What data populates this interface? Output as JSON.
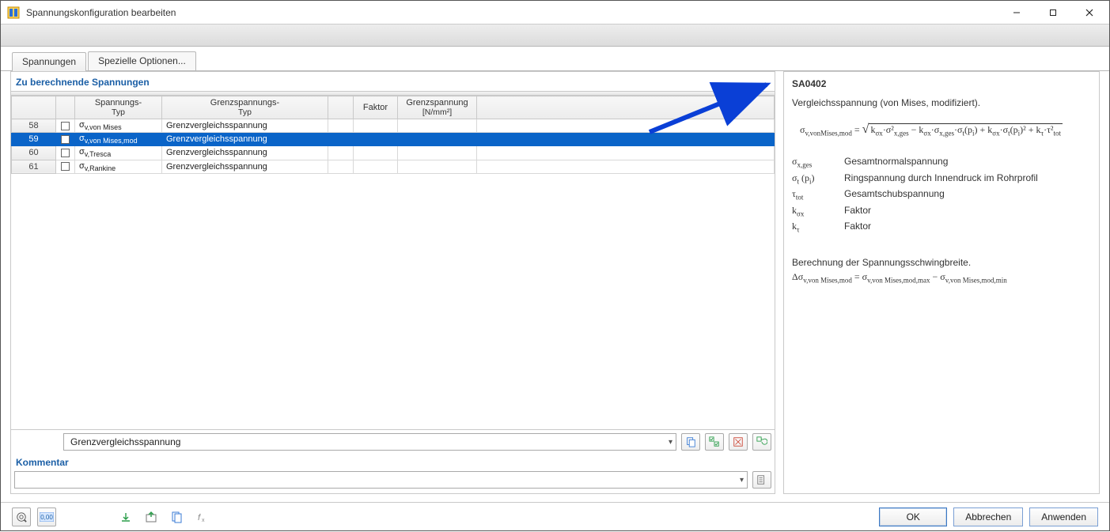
{
  "window": {
    "title": "Spannungskonfiguration bearbeiten"
  },
  "tabs": {
    "t1": "Spannungen",
    "t2": "Spezielle Optionen..."
  },
  "section": {
    "title": "Zu berechnende Spannungen"
  },
  "grid": {
    "headers": {
      "col_a": "",
      "col_b": "",
      "col_type_1": "Spannungs-",
      "col_type_2": "Typ",
      "col_limit_1": "Grenzspannungs-",
      "col_limit_2": "Typ",
      "col_empty1": "",
      "col_factor": "Faktor",
      "col_gs_1": "Grenzspannung",
      "col_gs_2": "[N/mm²]",
      "col_tail": ""
    },
    "rows": [
      {
        "num": "58",
        "type_html": "σ<span class='sub'>v,von Mises</span>",
        "limit": "Grenzvergleichsspannung",
        "selected": false
      },
      {
        "num": "59",
        "type_html": "σ<span class='sub'>v,von Mises,mod</span>",
        "limit": "Grenzvergleichsspannung",
        "selected": true
      },
      {
        "num": "60",
        "type_html": "σ<span class='sub'>v,Tresca</span>",
        "limit": "Grenzvergleichsspannung",
        "selected": false
      },
      {
        "num": "61",
        "type_html": "σ<span class='sub'>v,Rankine</span>",
        "limit": "Grenzvergleichsspannung",
        "selected": false
      }
    ],
    "dropdown_value": "Grenzvergleichsspannung"
  },
  "comment": {
    "label": "Kommentar",
    "value": ""
  },
  "info": {
    "code": "SA0402",
    "desc": "Vergleichsspannung (von Mises, modifiziert).",
    "legend": {
      "r1_sym": "σ<span class='sub'>x,ges</span>",
      "r1_txt": "Gesamtnormalspannung",
      "r2_sym": "σ<span class='sub'>t</span> (p<span class='sub'>i</span>)",
      "r2_txt": "Ringspannung durch Innendruck im Rohrprofil",
      "r3_sym": "τ<span class='sub'>tot</span>",
      "r3_txt": "Gesamtschubspannung",
      "r4_sym": "k<span class='sub'>σx</span>",
      "r4_txt": "Faktor",
      "r5_sym": "k<span class='sub'>τ</span>",
      "r5_txt": "Faktor"
    },
    "note_line1": "Berechnung der Spannungsschwingbreite.",
    "note_eq_html": "Δσ<span class='sub'>v,von Mises,mod</span> = σ<span class='sub'>v,von Mises,mod,max</span> − σ<span class='sub'>v,von Mises,mod,min</span>"
  },
  "footer": {
    "ok": "OK",
    "cancel": "Abbrechen",
    "apply": "Anwenden"
  }
}
